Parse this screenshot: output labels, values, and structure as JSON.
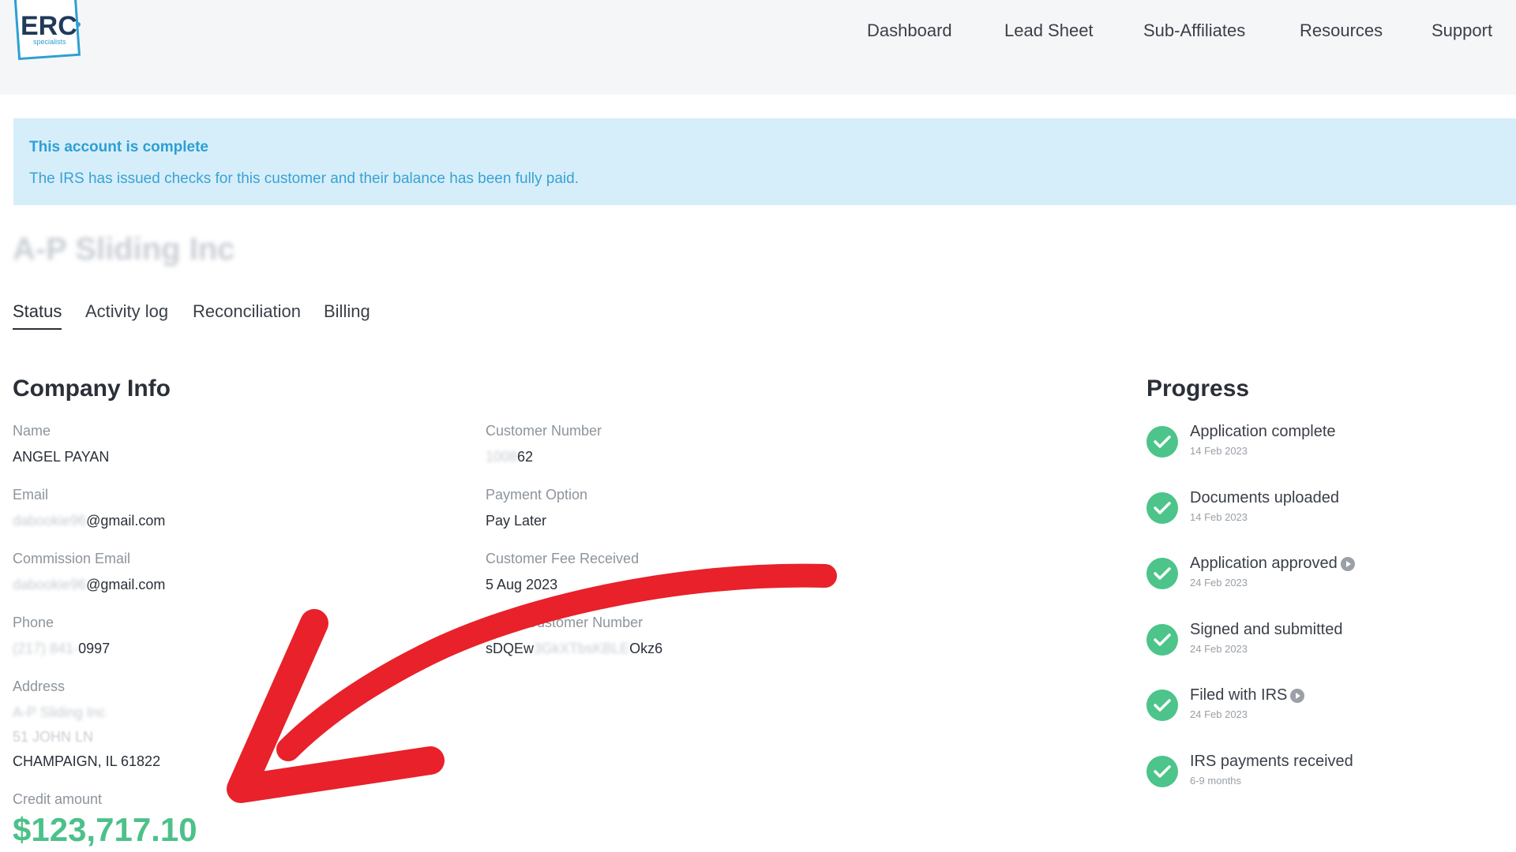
{
  "header": {
    "logo_text": "ERC",
    "logo_sub": "specialists",
    "nav": [
      "Dashboard",
      "Lead Sheet",
      "Sub-Affiliates",
      "Resources",
      "Support"
    ]
  },
  "alert": {
    "title": "This account is complete",
    "body": "The IRS has issued checks for this customer and their balance has been fully paid."
  },
  "company": {
    "title": "A-P Sliding Inc"
  },
  "tabs": [
    "Status",
    "Activity log",
    "Reconciliation",
    "Billing"
  ],
  "company_info": {
    "heading": "Company Info",
    "name_label": "Name",
    "name_value": "ANGEL PAYAN",
    "email_label": "Email",
    "email_hidden": "dabookie96",
    "email_visible": "@gmail.com",
    "commission_email_label": "Commission Email",
    "commission_email_hidden": "dabookie96",
    "commission_email_visible": "@gmail.com",
    "phone_label": "Phone",
    "phone_hidden": "(217) 841-",
    "phone_visible": "0997",
    "address_label": "Address",
    "address_line1": "A-P Sliding Inc",
    "address_line2": "51 JOHN LN",
    "address_line3": "CHAMPAIGN, IL 61822",
    "credit_label": "Credit amount",
    "credit_value": "$123,717.10",
    "customer_number_label": "Customer Number",
    "customer_number_hidden": "1008",
    "customer_number_visible": "62",
    "payment_option_label": "Payment Option",
    "payment_option_value": "Pay Later",
    "fee_received_label": "Customer Fee Received",
    "fee_received_value": "5 Aug 2023",
    "stripe_label_hidden": "Stripe",
    "stripe_label_visible": "Customer Number",
    "stripe_hidden_prefix": "sDQEw",
    "stripe_hidden_mid": "3GkXTbsKBLE",
    "stripe_visible_suffix": "Okz6"
  },
  "progress": {
    "heading": "Progress",
    "steps": [
      {
        "label": "Application complete",
        "date": "14 Feb 2023"
      },
      {
        "label": "Documents uploaded",
        "date": "14 Feb 2023"
      },
      {
        "label": "Application approved",
        "date": "24 Feb 2023"
      },
      {
        "label": "Signed and submitted",
        "date": "24 Feb 2023"
      },
      {
        "label": "Filed with IRS",
        "date": "24 Feb 2023"
      },
      {
        "label": "IRS payments received",
        "date": "6-9 months"
      }
    ]
  },
  "colors": {
    "accent_green": "#4cc18a",
    "alert_bg": "#d6eef9",
    "alert_text": "#2d9fd3",
    "arrow_red": "#e8212a"
  },
  "icons": [
    "check-icon",
    "play-icon",
    "arrow-annotation"
  ]
}
